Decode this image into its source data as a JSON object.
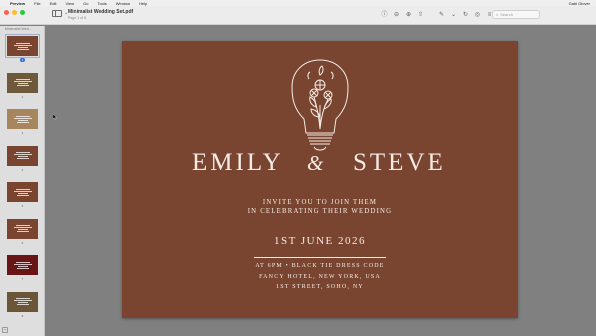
{
  "menubar": {
    "items": [
      "Preview",
      "File",
      "Edit",
      "View",
      "Go",
      "Tools",
      "Window",
      "Help"
    ],
    "right_label": "Gabi Glover"
  },
  "toolbar": {
    "doc_title": "Minimalist Wedding Set.pdf",
    "doc_sub": "Page 1 of 8",
    "search_placeholder": "Search"
  },
  "sidebar": {
    "title": "Minimalist Wed...",
    "pages": [
      {
        "n": "1",
        "color": "#7a4530",
        "selected": true
      },
      {
        "n": "2",
        "color": "#6e5a3a",
        "selected": false
      },
      {
        "n": "3",
        "color": "#a7855f",
        "selected": false
      },
      {
        "n": "4",
        "color": "#7a4530",
        "selected": false
      },
      {
        "n": "5",
        "color": "#7a4530",
        "selected": false
      },
      {
        "n": "6",
        "color": "#7a4530",
        "selected": false
      },
      {
        "n": "7",
        "color": "#6a1515",
        "selected": false
      },
      {
        "n": "8",
        "color": "#6b5638",
        "selected": false
      }
    ]
  },
  "card": {
    "name_left": "EMILY",
    "ampersand": "&",
    "name_right": "STEVE",
    "invite_line1": "INVITE YOU TO JOIN THEM",
    "invite_line2": "IN CELEBRATING THEIR WEDDING",
    "date": "1ST JUNE 2026",
    "time_dress": "AT 6PM • BLACK TIE DRESS CODE",
    "venue": "FANCY HOTEL, NEW YORK, USA",
    "street": "1ST STREET, SOHO, NY",
    "bg_color": "#7a4530"
  }
}
